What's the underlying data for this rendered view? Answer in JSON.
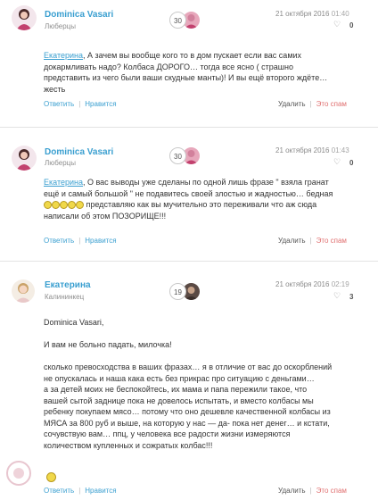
{
  "comments": [
    {
      "author": "Dominica Vasari",
      "city": "Люберцы",
      "badge": "30",
      "date": "21 октября 2016",
      "time": "01:40",
      "likes": "0",
      "mention": "Екатерина",
      "text_lines": [
        ", А зачем вы вообще кого то в дом пускает если вас самих",
        "докармливать надо? Колбаса ДОРОГО… тогда все ясно ( страшно",
        "представить из чего были ваши скудные манты)! И вы ещё второго ждёте…",
        "жесть"
      ]
    },
    {
      "author": "Dominica Vasari",
      "city": "Люберцы",
      "badge": "30",
      "date": "21 октября 2016",
      "time": "01:43",
      "likes": "0",
      "mention": "Екатерина",
      "text_lines": [
        ", О вас выводы уже сделаны по одной лишь фразе \" взяла гранат",
        "ещё и самый большой \" не подавитесь своей злостью и жадностью… бедная",
        " представляю как вы мучительно это переживали что аж сюда",
        "написали об этом ПОЗОРИЩЕ!!!"
      ],
      "emoji_count": 5
    },
    {
      "author": "Екатерина",
      "city": "Калининкец",
      "badge": "19",
      "date": "21 октября 2016",
      "time": "02:19",
      "likes": "3",
      "mention": "Dominica Vasari",
      "mention_suffix": ",",
      "greeting": "И вам не больно падать, милочка!",
      "paragraph_lines": [
        "сколько превосходства в ваших фразах… я в отличие от вас до оскорблений",
        "не опускалась и наша кака есть без прикрас про ситуацию с деньгами…",
        "а за детей моих не беспокойтесь, их мама и папа пережили такое, что",
        "вашей сытой заднице пока не довелось испытать, и вместо колбасы мы",
        "ребенку покупаем мясо… потому что оно дешевле качественной колбасы из",
        "МЯСА за 800 руб и выше, на которую у нас — да- пока нет денег… и кстати,",
        "сочувствую вам… ппц, у человека все радости жизни измеряются",
        "количеством купленных и сожратых колбас!!!"
      ]
    }
  ],
  "actions": {
    "reply": "Ответить",
    "like": "Нравится",
    "delete": "Удалить",
    "spam": "Это спам"
  },
  "icons": {
    "like": "heart-icon",
    "logo": "site-logo-icon"
  },
  "colors": {
    "link": "#3a9fd0",
    "spam": "#e07070",
    "divider": "#e3e3e3"
  }
}
